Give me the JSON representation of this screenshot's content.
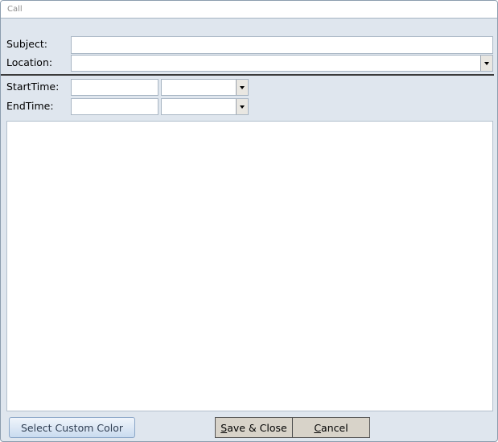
{
  "window": {
    "title": "Call"
  },
  "form": {
    "subject": {
      "label": "Subject:",
      "value": ""
    },
    "location": {
      "label": "Location:",
      "value": ""
    },
    "start_time": {
      "label": "StartTime:",
      "date_value": "",
      "time_value": ""
    },
    "end_time": {
      "label": "EndTime:",
      "date_value": "",
      "time_value": ""
    },
    "notes": {
      "value": ""
    }
  },
  "buttons": {
    "select_custom_color": "Select Custom Color",
    "save_close": {
      "mnemonic": "S",
      "rest": "ave & Close"
    },
    "cancel": {
      "mnemonic": "C",
      "rest": "ancel"
    }
  },
  "icons": {
    "dropdown_arrow": "chevron-down-icon"
  },
  "colors": {
    "form_background": "#dfe6ee",
    "title_text": "#8d8d8d",
    "command_button": "#d8d3c9",
    "custom_color_button": "#c9dbef"
  }
}
